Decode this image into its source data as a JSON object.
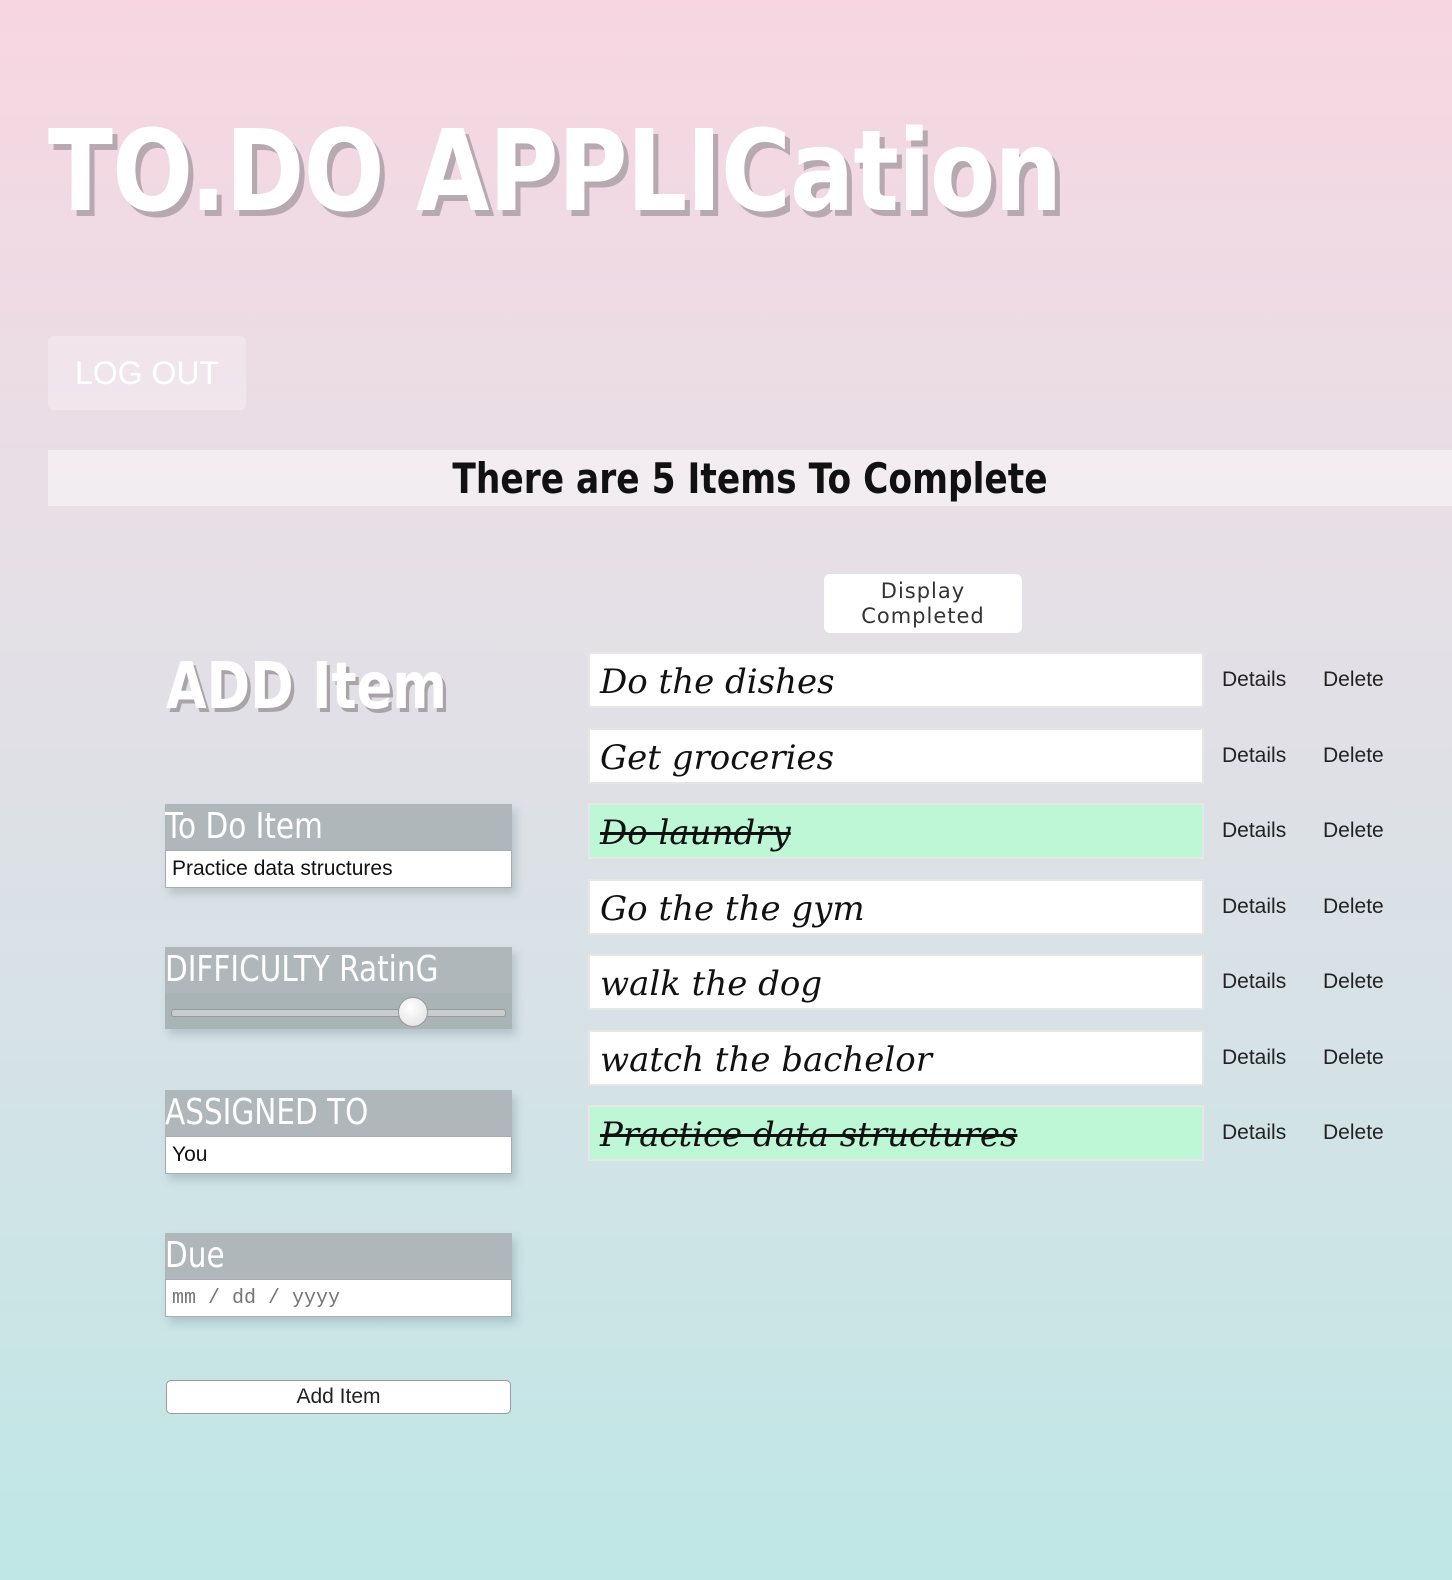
{
  "header": {
    "title": "TO.DO APPLICation",
    "logout_label": "LOG OUT"
  },
  "banner": {
    "text": "There are 5 Items To Complete"
  },
  "list_controls": {
    "display_completed_label": "Display Completed"
  },
  "add_form": {
    "heading": "ADD Item",
    "todo_label": "To Do Item",
    "todo_value": "Practice data structures",
    "difficulty_label": "DIFFICULTY RatinG",
    "difficulty_value": 0.72,
    "assigned_label": "ASSIGNED TO",
    "assigned_value": "You",
    "due_label": "Due",
    "due_placeholder": "mm / dd / yyyy",
    "submit_label": "Add Item"
  },
  "todos": [
    {
      "text": "Do the dishes",
      "completed": false,
      "details_label": "Details",
      "delete_label": "Delete"
    },
    {
      "text": "Get groceries",
      "completed": false,
      "details_label": "Details",
      "delete_label": "Delete"
    },
    {
      "text": "Do laundry",
      "completed": true,
      "details_label": "Details",
      "delete_label": "Delete"
    },
    {
      "text": "Go the the gym",
      "completed": false,
      "details_label": "Details",
      "delete_label": "Delete"
    },
    {
      "text": "walk the dog",
      "completed": false,
      "details_label": "Details",
      "delete_label": "Delete"
    },
    {
      "text": "watch the bachelor",
      "completed": false,
      "details_label": "Details",
      "delete_label": "Delete"
    },
    {
      "text": "Practice data structures",
      "completed": true,
      "details_label": "Details",
      "delete_label": "Delete"
    }
  ],
  "colors": {
    "completed_bg": "#bdf7d6",
    "label_bg": "#b0b7ba"
  }
}
